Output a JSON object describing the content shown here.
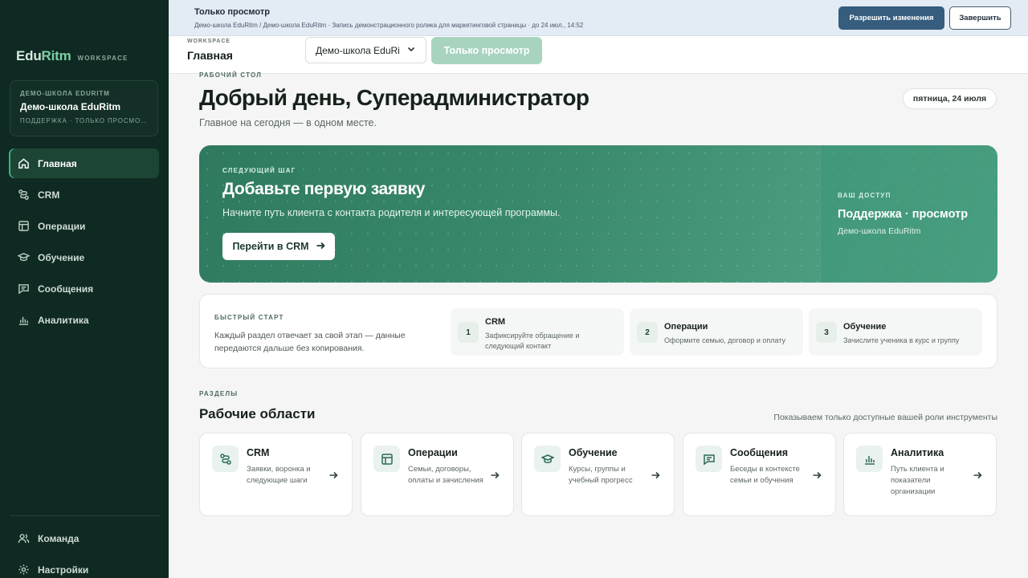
{
  "sidebar": {
    "logo": "EduRitm",
    "logo_accent": "Ritm",
    "logo_prefix": "Edu",
    "logo_sub": "WORKSPACE",
    "org_kicker": "ДЕМО-ШКОЛА EDURITM",
    "org_name": "Демо-школа EduRitm",
    "org_role": "ПОДДЕРЖКА · ТОЛЬКО ПРОСМОТР",
    "items": [
      {
        "label": "Главная",
        "icon": "home-icon",
        "active": true
      },
      {
        "label": "CRM",
        "icon": "crm-icon"
      },
      {
        "label": "Операции",
        "icon": "table-icon"
      },
      {
        "label": "Обучение",
        "icon": "graduation-cap-icon"
      },
      {
        "label": "Сообщения",
        "icon": "message-icon"
      },
      {
        "label": "Аналитика",
        "icon": "chart-icon"
      }
    ],
    "bottom_items": [
      {
        "label": "Команда",
        "icon": "team-icon"
      },
      {
        "label": "Настройки",
        "icon": "gear-icon"
      }
    ]
  },
  "banner": {
    "title": "Только просмотр",
    "subtitle": "Демо-школа EduRitm / Демо-школа EduRitm · Запись демонстрационного ролика для маркетинговой страницы · до 24 июл., 14:52",
    "allow_label": "Разрешить изменения",
    "finish_label": "Завершить",
    "allow_color": "#365c7e"
  },
  "header": {
    "ws_kicker": "WORKSPACE",
    "ws_title": "Главная",
    "school_select": "Демо-школа EduRi",
    "readonly_label": "Только просмотр"
  },
  "main": {
    "kicker": "РАБОЧИЙ СТОЛ",
    "greeting": "Добрый день, Суперадминистратор",
    "subtitle": "Главное на сегодня — в одном месте.",
    "date": "пятница, 24 июля"
  },
  "hero": {
    "kicker": "СЛЕДУЮЩИЙ ШАГ",
    "title": "Добавьте первую заявку",
    "desc": "Начните путь клиента с контакта родителя и интересующей программы.",
    "button": "Перейти в CRM",
    "access_kicker": "ВАШ ДОСТУП",
    "access_title": "Поддержка · просмотр",
    "access_sub": "Демо-школа EduRitm",
    "accent_color": "#3a8a6c"
  },
  "quick": {
    "kicker": "БЫСТРЫЙ СТАРТ",
    "desc": "Каждый раздел отвечает за свой этап — данные передаются дальше без копирования.",
    "steps": [
      {
        "num": "1",
        "title": "CRM",
        "desc": "Зафиксируйте обращение и следующий контакт"
      },
      {
        "num": "2",
        "title": "Операции",
        "desc": "Оформите семью, договор и оплату"
      },
      {
        "num": "3",
        "title": "Обучение",
        "desc": "Зачислите ученика в курс и группу"
      }
    ]
  },
  "sections": {
    "kicker": "РАЗДЕЛЫ",
    "title": "Рабочие области",
    "note": "Показываем только доступные вашей роли инструменты",
    "cards": [
      {
        "title": "CRM",
        "desc": "Заявки, воронка и следующие шаги",
        "icon": "crm-icon"
      },
      {
        "title": "Операции",
        "desc": "Семьи, договоры, оплаты и зачисления",
        "icon": "table-icon"
      },
      {
        "title": "Обучение",
        "desc": "Курсы, группы и учебный прогресс",
        "icon": "graduation-cap-icon"
      },
      {
        "title": "Сообщения",
        "desc": "Беседы в контексте семьи и обучения",
        "icon": "message-icon"
      },
      {
        "title": "Аналитика",
        "desc": "Путь клиента и показатели организации",
        "icon": "chart-icon"
      }
    ]
  }
}
